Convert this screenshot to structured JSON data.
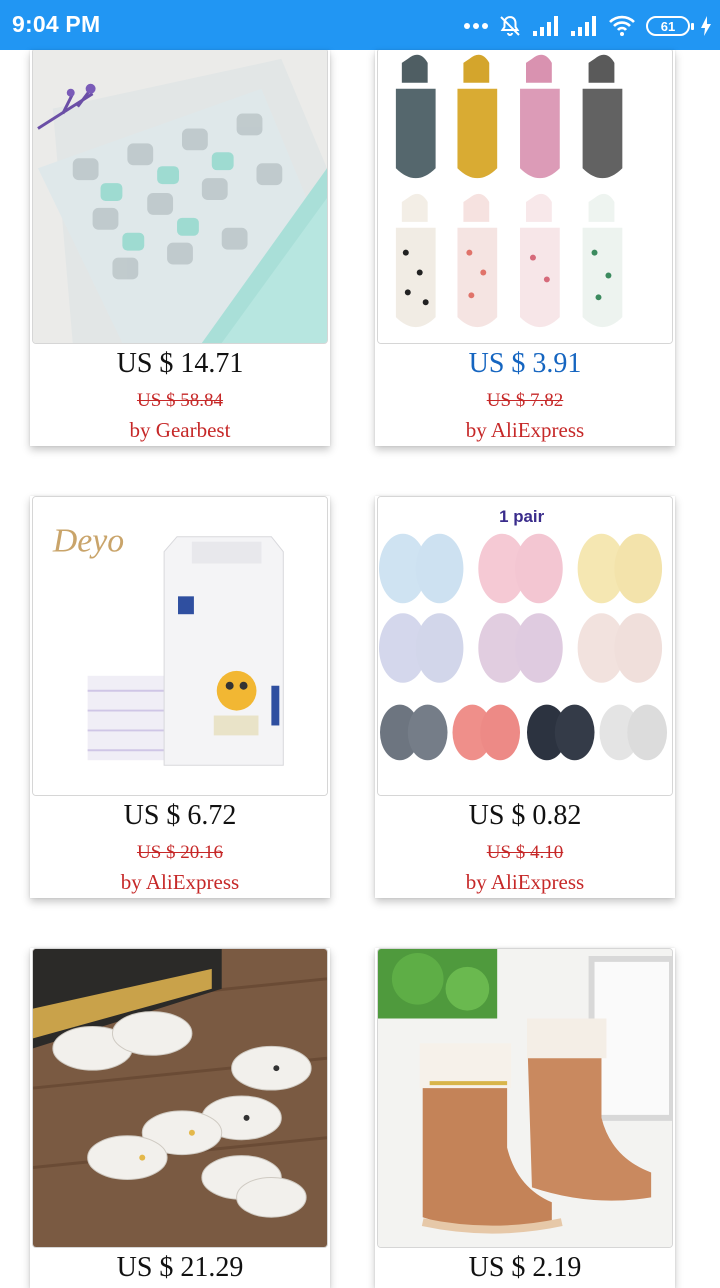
{
  "status_bar": {
    "time": "9:04 PM",
    "battery": "61"
  },
  "products": [
    {
      "price": "US $ 14.71",
      "original_price": "US $ 58.84",
      "seller": "by Gearbest"
    },
    {
      "price": "US $ 3.91",
      "original_price": "US $ 7.82",
      "seller": "by AliExpress"
    },
    {
      "price": "US $ 6.72",
      "original_price": "US $ 20.16",
      "seller": "by AliExpress",
      "image_text": "Deyo"
    },
    {
      "price": "US $ 0.82",
      "original_price": "US $ 4.10",
      "seller": "by AliExpress",
      "image_text": "1 pair"
    },
    {
      "price": "US $ 21.29"
    },
    {
      "price": "US $ 2.19"
    }
  ]
}
